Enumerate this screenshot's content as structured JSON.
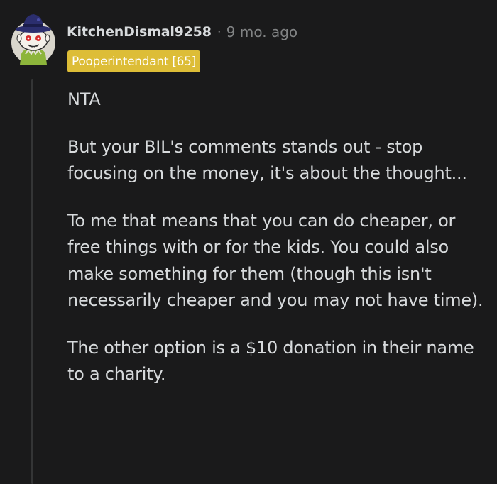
{
  "comment": {
    "author": "KitchenDismal9258",
    "separator": "·",
    "age": "9 mo. ago",
    "flair": "Pooperintendant [65]",
    "paragraphs": [
      "NTA",
      "But your BIL's comments stands out - stop focusing on the money, it's about the thought...",
      "To me that means that you can do cheaper, or free things with or for the kids. You could also make something for them (though this isn't necessarily cheaper and you may not have time).",
      "The other option is a $10 donation in their name to a charity."
    ]
  },
  "colors": {
    "background": "#1a1a1b",
    "text": "#d7dadc",
    "muted": "#818384",
    "flair_bg": "#ddbd37",
    "thread_line": "#343536"
  },
  "avatar_icon": "snoo-avatar-top-hat-icon"
}
